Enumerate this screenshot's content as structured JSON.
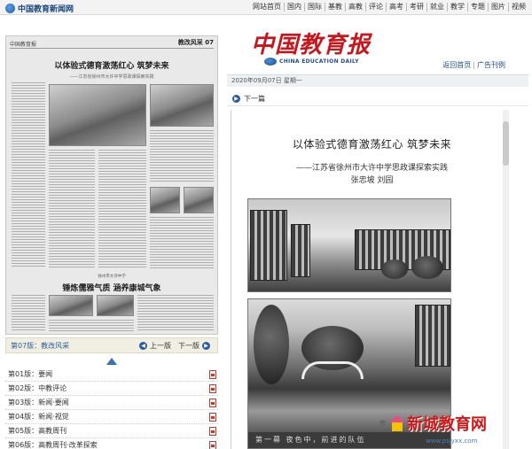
{
  "site": {
    "logo_text": "中国教育新闻网",
    "nav": [
      "网站首页",
      "国内",
      "国际",
      "基教",
      "高教",
      "评论",
      "高考",
      "考研",
      "就业",
      "教学",
      "专题",
      "图片",
      "视频"
    ]
  },
  "paper_thumb": {
    "masthead_left": "中国教育报",
    "masthead_right": "教改风采 07",
    "headline": "以体验式德育激荡红心 筑梦未来",
    "subline": "——江苏省徐州市大许中学思政课探索实践",
    "kicker": "徐州市大许中学",
    "headline2": "锤炼儒雅气质 涵养康城气象"
  },
  "page_bar": {
    "current": "第07版：教改风采",
    "prev": "上一版",
    "next": "下一版"
  },
  "pages": [
    "第01版：要闻",
    "第02版：中教评论",
    "第03版：新闻·要闻",
    "第04版：新闻·视觉",
    "第05版：高教周刊",
    "第06版：高教周刊·改革探索"
  ],
  "right": {
    "logo_cn": "中国教育报",
    "logo_en": "CHINA EDUCATION DAILY",
    "link_back": "返回首页",
    "link_ads": "广告刊例",
    "date": "2020年09月07日 星期一",
    "next_article": "下一篇"
  },
  "article": {
    "title": "以体验式德育激荡红心 筑梦未来",
    "subtitle": "——江苏省徐州市大许中学思政课探索实践",
    "authors": "张忠坡 刘园",
    "photo_banner": "第一幕   夜色中，前进的队伍"
  },
  "watermark": {
    "brand": "新城教育网",
    "url": "www.psjyxx.com"
  }
}
